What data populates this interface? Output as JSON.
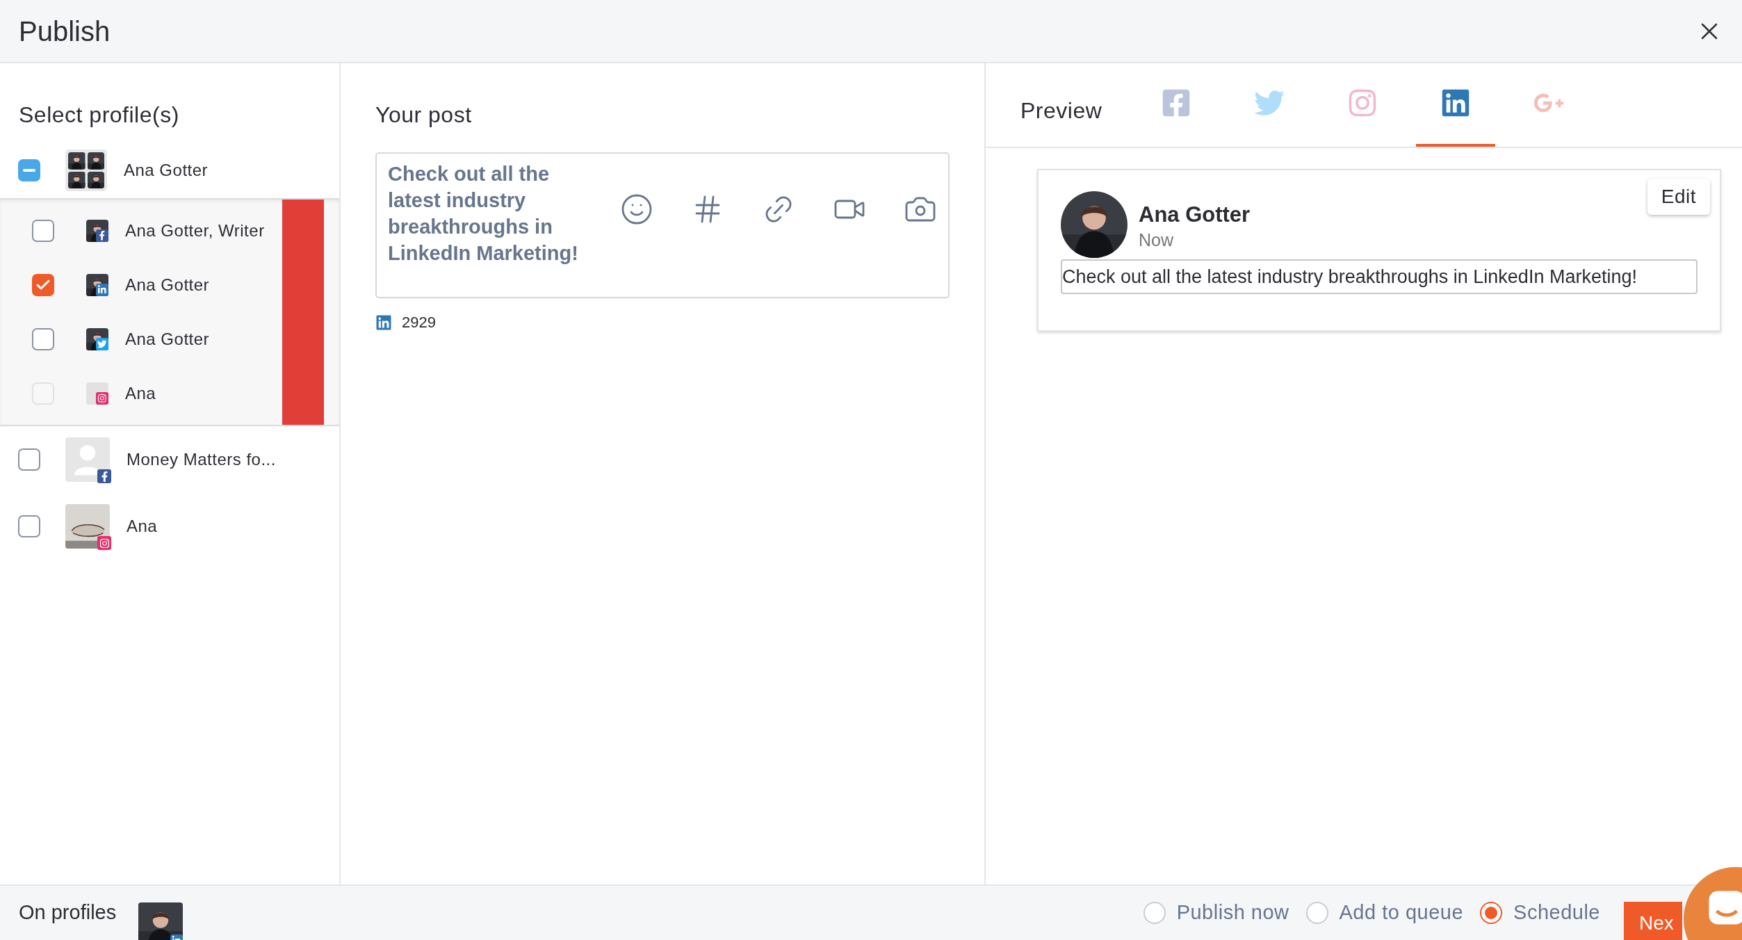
{
  "title": "Publish",
  "profiles": {
    "heading": "Select profile(s)",
    "entries": [
      {
        "kind": "group",
        "name": "Ana Gotter",
        "indeterminate": true,
        "expanded": true,
        "children": [
          {
            "name": "Ana Gotter, Writer",
            "kind": "facebook",
            "checked": false,
            "disabled": false
          },
          {
            "name": "Ana Gotter",
            "kind": "linkedin",
            "checked": true,
            "disabled": false
          },
          {
            "name": "Ana Gotter",
            "kind": "twitter",
            "checked": false,
            "disabled": false
          },
          {
            "name": "Ana",
            "kind": "instagram",
            "checked": false,
            "disabled": true
          }
        ]
      },
      {
        "kind": "single",
        "name": "Money Matters fo...",
        "badge": {
          "kind": "facebook"
        },
        "avatar": {
          "kind": "placeholder"
        },
        "checked": false
      },
      {
        "kind": "single",
        "name": "Ana",
        "badge": {
          "kind": "instagram"
        },
        "checked": false
      }
    ]
  },
  "post": {
    "heading": "Your post",
    "text": "Check out all the latest industry breakthroughs in LinkedIn Marketing!",
    "counter": {
      "kind": "linkedin",
      "count": "2929"
    }
  },
  "preview": {
    "heading": "Preview",
    "tabs": [
      {
        "kind": "facebook",
        "selected": false
      },
      {
        "kind": "twitter",
        "selected": false
      },
      {
        "kind": "instagram",
        "selected": false
      },
      {
        "kind": "linkedin",
        "selected": true
      },
      {
        "kind": "googleplus",
        "selected": false
      }
    ],
    "card": {
      "name": "Ana Gotter",
      "time": "Now",
      "edit": "Edit",
      "text": "Check out all the latest industry breakthroughs in LinkedIn Marketing!"
    }
  },
  "footer": {
    "label": "On profiles",
    "options": [
      {
        "label": "Publish now",
        "selected": false
      },
      {
        "label": "Add to queue",
        "selected": false
      },
      {
        "label": "Schedule",
        "selected": true
      }
    ],
    "next": "Nex"
  }
}
